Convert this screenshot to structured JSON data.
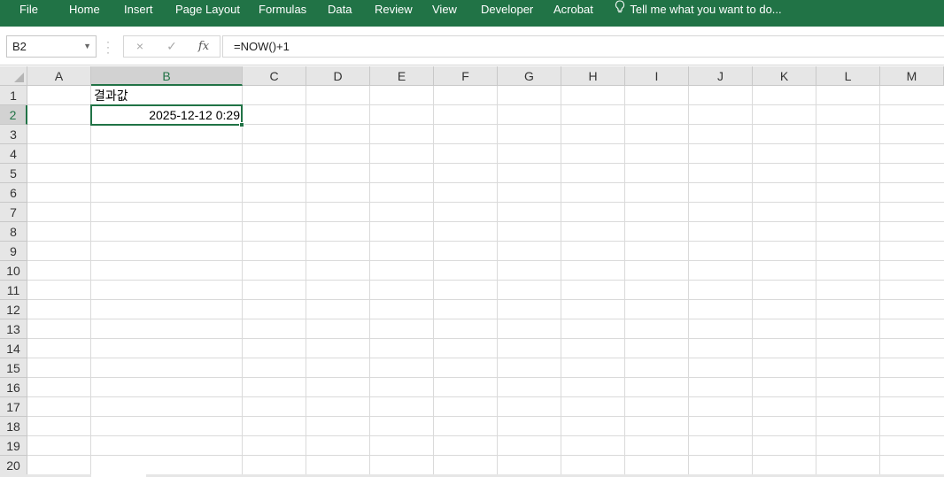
{
  "ribbon": {
    "tabs": [
      "File",
      "Home",
      "Insert",
      "Page Layout",
      "Formulas",
      "Data",
      "Review",
      "View",
      "Developer",
      "Acrobat"
    ],
    "tell_me": "Tell me what you want to do...",
    "tell_me_icon": "lightbulb-icon"
  },
  "formula_bar": {
    "name_box": "B2",
    "cancel_icon": "×",
    "enter_icon": "✓",
    "function_icon": "fx",
    "formula": "=NOW()+1"
  },
  "sheet": {
    "columns": [
      "A",
      "B",
      "C",
      "D",
      "E",
      "F",
      "G",
      "H",
      "I",
      "J",
      "K",
      "L",
      "M"
    ],
    "rows": [
      "1",
      "2",
      "3",
      "4",
      "5",
      "6",
      "7",
      "8",
      "9",
      "10",
      "11",
      "12",
      "13",
      "14",
      "15",
      "16",
      "17",
      "18",
      "19",
      "20"
    ],
    "selected_column": "B",
    "selected_row": "2",
    "cells": {
      "B1": "결과값",
      "B2": "2025-12-12 0:29"
    }
  },
  "colors": {
    "accent": "#217346",
    "ribbon_bg": "#217346",
    "header_bg": "#e6e6e6",
    "gridline": "#dadada"
  }
}
